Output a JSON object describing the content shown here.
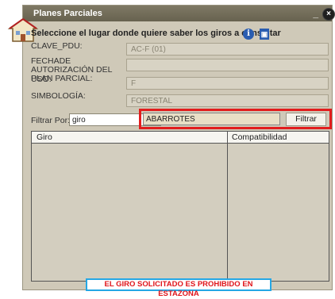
{
  "window": {
    "title": "Planes Parciales",
    "minimize": "_",
    "close": "×"
  },
  "instruction": "Seleccione el lugar donde quiere saber los giros a consultar",
  "fields": {
    "clave_pdu": {
      "label": "CLAVE_PDU:",
      "value": "AC-F (01)"
    },
    "fecha": {
      "label": "FECHADE AUTORIZACIÓN DEL PLAN PARCIAL:",
      "value": ""
    },
    "uso": {
      "label": "USO:",
      "value": "F"
    },
    "simbologia": {
      "label": "SIMBOLOGÍA:",
      "value": "FORESTAL"
    }
  },
  "filter": {
    "label": "Filtrar Por:",
    "select_value": "giro",
    "search_value": "ABARROTES",
    "button_label": "Filtrar"
  },
  "table": {
    "columns": [
      "Giro",
      "Compatibilidad"
    ]
  },
  "status": "EL GIRO SOLICITADO ES PROHIBIDO EN ESTAZONA",
  "colors": {
    "highlight_red": "#e21d1d",
    "status_blue": "#25a7e5",
    "status_text": "#e0151b"
  }
}
